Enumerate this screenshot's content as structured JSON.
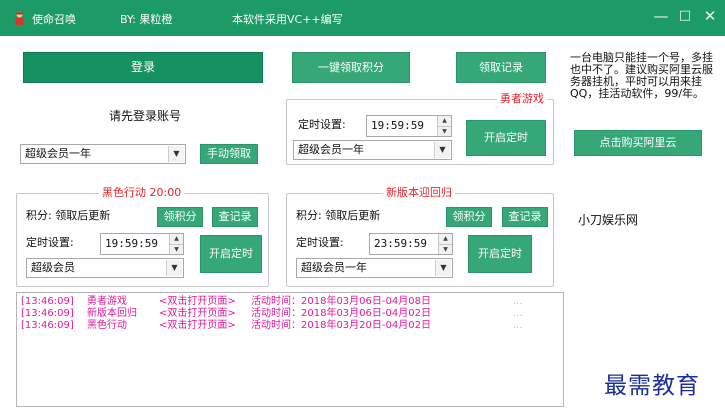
{
  "titlebar": {
    "app_name": "使命召唤",
    "author": "BY: 果粒橙",
    "note": "本软件采用VC++编写",
    "minimize_glyph": "—",
    "maximize_glyph": "□",
    "close_glyph": "✕"
  },
  "top": {
    "login_label": "登录",
    "claim_all_label": "一键领取积分",
    "claim_record_label": "领取记录"
  },
  "account": {
    "prompt": "请先登录账号",
    "membership_value": "超级会员一年",
    "manual_claim_label": "手动领取"
  },
  "hero_game": {
    "title": "勇者游戏",
    "timer_label": "定时设置:",
    "time_value": "19:59:59",
    "membership_value": "超级会员一年",
    "start_timer_label": "开启定时"
  },
  "black_ops": {
    "title": "黑色行动 20:00",
    "points_text": "积分: 领取后更新",
    "claim_points_label": "领积分",
    "check_record_label": "查记录",
    "timer_label": "定时设置:",
    "time_value": "19:59:59",
    "membership_value": "超级会员",
    "start_timer_label": "开启定时"
  },
  "new_return": {
    "title": "新版本迎回归",
    "points_text": "积分: 领取后更新",
    "claim_points_label": "领积分",
    "check_record_label": "查记录",
    "timer_label": "定时设置:",
    "time_value": "23:59:59",
    "membership_value": "超级会员一年",
    "start_timer_label": "开启定时"
  },
  "side": {
    "notice": "一台电脑只能挂一个号，多挂也中不了。建议购买阿里云服务器挂机，平时可以用来挂QQ，挂活动软件，99/年。",
    "buy_aliyun_label": "点击购买阿里云",
    "site_name": "小刀娱乐网"
  },
  "log": {
    "rows": [
      {
        "time": "[13:46:09]",
        "event": "勇者游戏",
        "action": "<双击打开页面>",
        "period": "活动时间：2018年03月06日-04月08日",
        "dots": "..."
      },
      {
        "time": "[13:46:09]",
        "event": "新版本回归",
        "action": "<双击打开页面>",
        "period": "活动时间：2018年03月06日-04月02日",
        "dots": "..."
      },
      {
        "time": "[13:46:09]",
        "event": "黑色行动",
        "action": "<双击打开页面>",
        "period": "活动时间：2018年03月20日-04月02日",
        "dots": "..."
      }
    ]
  },
  "watermark": "最需教育",
  "colors": {
    "titlebar": "#1d9b66",
    "button": "#179161",
    "accent_red": "#e2262c",
    "log_text": "#e0199a",
    "watermark": "#1a2f9e"
  }
}
